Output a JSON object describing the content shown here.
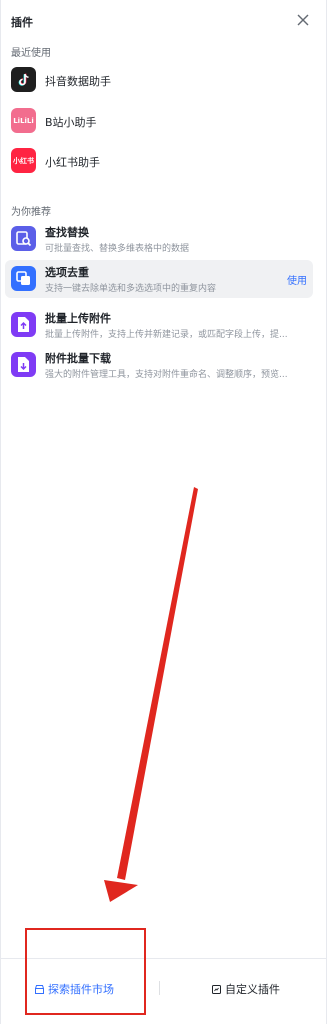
{
  "header": {
    "title": "插件"
  },
  "recent": {
    "title": "最近使用",
    "items": [
      {
        "name": "抖音数据助手",
        "logo_icon": "douyin-icon",
        "color": "#1f1f1f"
      },
      {
        "name": "B站小助手",
        "logo_icon": "bilibili-icon",
        "logo_text": "LiLiLi",
        "color": "#f26d8e"
      },
      {
        "name": "小红书助手",
        "logo_icon": "xiaohongshu-icon",
        "logo_text": "小红书",
        "color": "#ff2442"
      }
    ]
  },
  "recommend": {
    "title": "为你推荐",
    "items": [
      {
        "name": "查找替换",
        "desc": "可批量查找、替换多维表格中的数据",
        "icon": "find-replace-icon",
        "color": "#5b5fe8"
      },
      {
        "name": "选项去重",
        "desc": "支持一键去除单选和多选选项中的重复内容",
        "icon": "dedupe-icon",
        "color": "#3370ff",
        "action": "使用"
      },
      {
        "name": "批量上传附件",
        "desc": "批量上传附件，支持上传并新建记录，或匹配字段上传，提...",
        "icon": "upload-attachment-icon",
        "color": "#7f3bf5"
      },
      {
        "name": "附件批量下载",
        "desc": "强大的附件管理工具，支持对附件重命名、调整顺序，预览...",
        "icon": "download-attachment-icon",
        "color": "#7f3bf5"
      }
    ]
  },
  "footer": {
    "explore_label": "探索插件市场",
    "custom_label": "自定义插件"
  },
  "colors": {
    "accent": "#3370ff",
    "annotation": "#e0271f"
  }
}
